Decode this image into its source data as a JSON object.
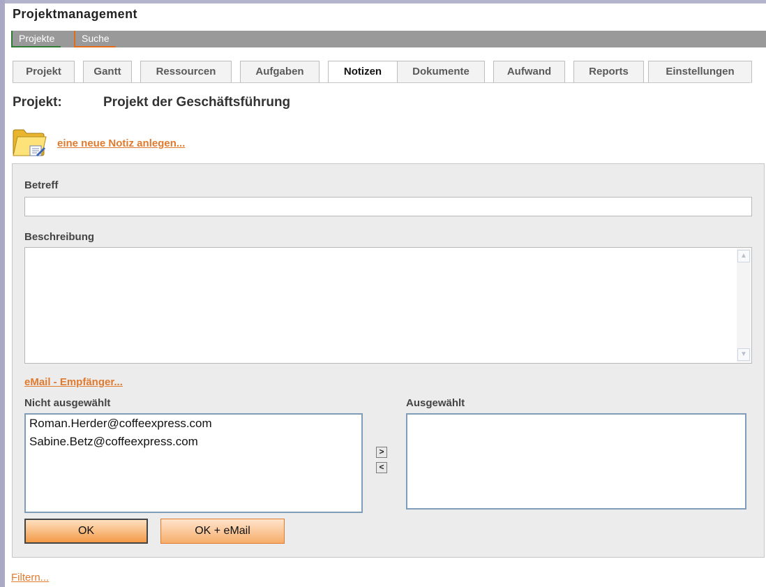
{
  "app": {
    "title": "Projektmanagement"
  },
  "nav": {
    "items": [
      {
        "label": "Projekte"
      },
      {
        "label": "Suche"
      }
    ]
  },
  "tabs": [
    {
      "label": "Projekt"
    },
    {
      "label": "Gantt"
    },
    {
      "label": "Ressourcen"
    },
    {
      "label": "Aufgaben"
    },
    {
      "label": "Notizen",
      "active": true
    },
    {
      "label": "Dokumente"
    },
    {
      "label": "Aufwand"
    },
    {
      "label": "Reports"
    },
    {
      "label": "Einstellungen"
    }
  ],
  "project": {
    "label": "Projekt:",
    "name": "Projekt der Geschäftsführung"
  },
  "new_note": {
    "icon": "folder-note-icon",
    "link": "eine neue Notiz anlegen..."
  },
  "form": {
    "betreff": {
      "label": "Betreff",
      "value": ""
    },
    "beschreibung": {
      "label": "Beschreibung",
      "value": ""
    },
    "email_link": "eMail - Empfänger...",
    "not_selected": {
      "label": "Nicht ausgewählt",
      "items": [
        "Roman.Herder@coffeexpress.com",
        "Sabine.Betz@coffeexpress.com"
      ]
    },
    "selected": {
      "label": "Ausgewählt",
      "items": []
    },
    "move_right": ">",
    "move_left": "<",
    "ok_label": "OK",
    "ok_email_label": "OK + eMail"
  },
  "filter_link": "Filtern...",
  "colors": {
    "accent": "#e07a2f",
    "nav_bar": "#999999",
    "panel": "#ececec"
  }
}
